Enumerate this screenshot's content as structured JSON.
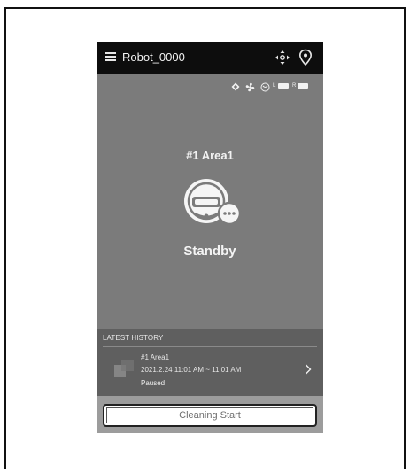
{
  "header": {
    "robot_name": "Robot_0000"
  },
  "status_icons": [
    "diamond-icon",
    "fan-icon",
    "mop-icon",
    "battery-left-icon",
    "battery-right-icon"
  ],
  "battery": {
    "left_label": "L",
    "right_label": "R"
  },
  "main": {
    "area_name": "#1 Area1",
    "state": "Standby"
  },
  "history": {
    "title": "LATEST HISTORY",
    "items": [
      {
        "area": "#1 Area1",
        "time": "2021.2.24 11:01 AM ~ 11:01 AM",
        "status": "Paused"
      }
    ]
  },
  "actions": {
    "start_label": "Cleaning Start"
  }
}
